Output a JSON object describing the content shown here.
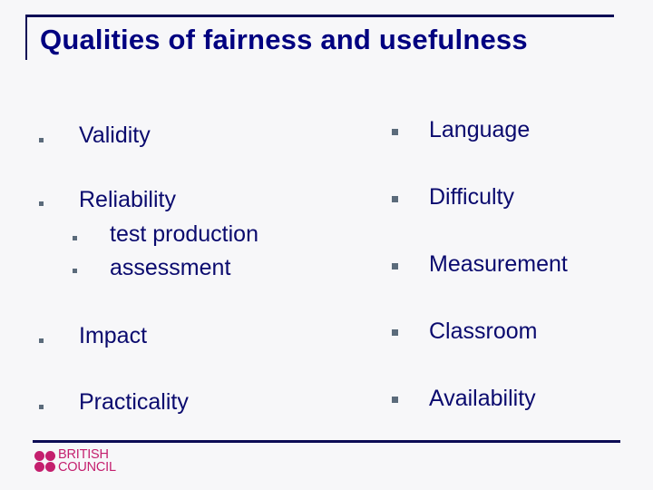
{
  "slide": {
    "title": "Qualities of fairness and usefulness"
  },
  "left_column": {
    "items": [
      {
        "label": "Validity"
      },
      {
        "label": "Reliability",
        "subitems": [
          {
            "label": "test production"
          },
          {
            "label": "assessment"
          }
        ]
      },
      {
        "label": "Impact"
      },
      {
        "label": "Practicality"
      }
    ]
  },
  "right_column": {
    "items": [
      {
        "label": "Language"
      },
      {
        "label": "Difficulty"
      },
      {
        "label": "Measurement"
      },
      {
        "label": "Classroom"
      },
      {
        "label": "Availability"
      }
    ]
  },
  "footer": {
    "logo_line1": "BRITISH",
    "logo_line2": "COUNCIL",
    "logo_icon": "four-dots-logo-icon",
    "brand_color": "#c41f6e"
  },
  "colors": {
    "title": "#000080",
    "text": "#0a0a6e",
    "rule": "#0c0c55",
    "bullet": "#5b6b7b"
  }
}
